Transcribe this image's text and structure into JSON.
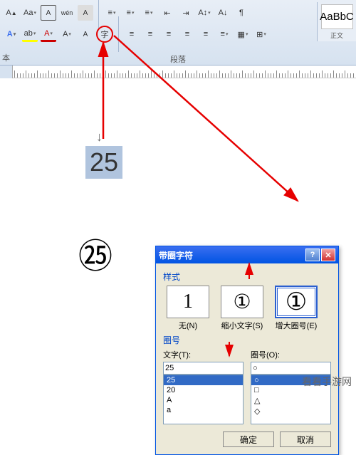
{
  "ribbon": {
    "group_label": "段落",
    "style_preview": "AaBbC",
    "style_name": "正文",
    "row1": [
      "A",
      "Aa",
      "A",
      "A",
      "A",
      "≡",
      "≡",
      "≡",
      "·",
      "≡",
      "↕",
      "A↓",
      "⚓",
      "↕"
    ],
    "row2": [
      "A",
      "A",
      "A",
      "A",
      "A",
      "字",
      "≡",
      "≡",
      "≡",
      "≡",
      "≡",
      "≡",
      "⊞"
    ]
  },
  "document": {
    "selected": "25",
    "result": "㉕"
  },
  "dialog": {
    "title": "带圈字符",
    "section_style": "样式",
    "styles": {
      "none": {
        "glyph": "1",
        "label": "无(N)"
      },
      "shrink": {
        "glyph": "①",
        "label": "缩小文字(S)"
      },
      "enlarge": {
        "glyph": "①",
        "label": "增大圈号(E)"
      }
    },
    "section_ring": "圈号",
    "text_label": "文字(T):",
    "ring_label": "圈号(O):",
    "text_value": "25",
    "text_options": [
      "25",
      "20",
      "A",
      "a"
    ],
    "ring_value": "○",
    "ring_options": [
      "○",
      "□",
      "△",
      "◇"
    ],
    "ok": "确定",
    "cancel": "取消"
  },
  "watermark": "看看手游网"
}
